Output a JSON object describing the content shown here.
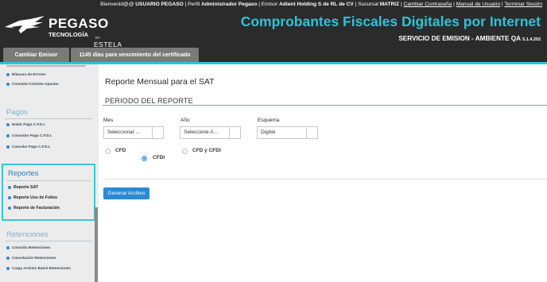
{
  "header": {
    "welcome_prefix": "Bienvenid@@",
    "user": "USUARIO PEGASO",
    "perfil_label": "Perfil",
    "perfil": "Administrador Pegaso",
    "emisor_label": "Emisor",
    "emisor": "Adient Holding S de RL de CV",
    "sucursal_label": "Sucursal",
    "sucursal": "MATRIZ",
    "link_password": "Cambiar Contraseña",
    "link_manual": "Manual de Usuario",
    "link_logout": "Terminar Sesión",
    "app_title": "Comprobantes Fiscales Digitales por Internet",
    "environment": "SERVICIO DE EMISION - AMBIENTE QA",
    "version": "5.1.4.202"
  },
  "logo": {
    "main": "PEGASO",
    "sub": "TECNOLOGÍA",
    "by": "BY",
    "estela": "ESTELA"
  },
  "tabs": {
    "cambiar_emisor": "Cambiar Emisor",
    "certificado": "1145 días para vencimiento del certificado"
  },
  "sidebar": {
    "top_items": [
      "Bitacora de Errores",
      "Consulta Contrato Aparato"
    ],
    "pagos_title": "Pagos",
    "pagos_items": [
      "Emitir Pago C.F.D.I.",
      "Consultar Pago C.F.D.I.",
      "Cancelar Pago C.F.D.I."
    ],
    "reportes_title": "Reportes",
    "reportes_items": [
      "Reporte SAT",
      "Reporte Uso de Folios",
      "Reporte de Facturación"
    ],
    "retenciones_title": "Retenciones",
    "retenciones_items": [
      "Consulta Retenciones",
      "Cancelación Retenciones",
      "Carga Archivo Batch Retenciones"
    ]
  },
  "main": {
    "page_title": "Reporte Mensual para el SAT",
    "section_title": "PERIODO DEL REPORTE",
    "mes_label": "Mes",
    "mes_value": "Seleccionar ...",
    "ano_label": "Año",
    "ano_value": "Seleccione A...",
    "esquema_label": "Esquema",
    "esquema_value": "Digital",
    "radio_cfd": "CFD",
    "radio_cfd_cfdi": "CFD y CFDI",
    "radio_cfdi": "CFDI",
    "selected_radio": "CFDI",
    "button": "Generar Archivo"
  },
  "colors": {
    "accent": "#2ec4d4",
    "header_bg": "#2b2b2b",
    "button": "#2a8ad4"
  }
}
